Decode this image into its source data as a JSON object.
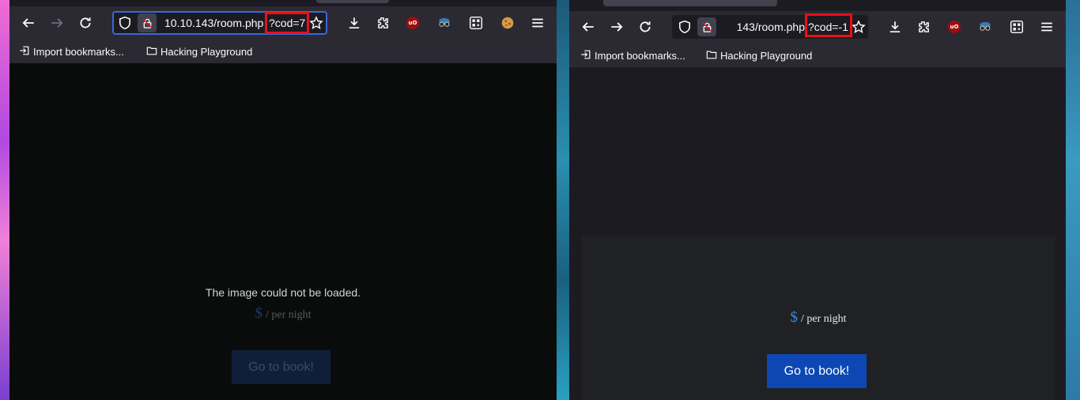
{
  "left_window": {
    "url_main": "10.10.143/room.php",
    "url_highlight": "?cod=7",
    "bookmarks": {
      "import": "Import bookmarks...",
      "folder": "Hacking Playground"
    },
    "image_error": "The image could not be loaded.",
    "price_symbol": "$",
    "price_suffix": "/ per night",
    "book_button": "Go to book!"
  },
  "right_window": {
    "url_main": "143/room.php",
    "url_highlight": "?cod=-1",
    "bookmarks": {
      "import": "Import bookmarks...",
      "folder": "Hacking Playground"
    },
    "price_symbol": "$",
    "price_suffix": "/ per night",
    "book_button": "Go to book!"
  },
  "colors": {
    "highlight_box": "#e8101a",
    "button_active": "#0d47b4",
    "button_dim": "#0f1f3a",
    "price_blue": "#3c8be0",
    "focus_ring": "#3d66d9"
  },
  "icons": [
    "back-arrow-icon",
    "forward-arrow-icon",
    "reload-icon",
    "shield-icon",
    "lock-slash-icon",
    "star-icon",
    "download-icon",
    "extensions-icon",
    "ublock-icon",
    "spy-glasses-icon",
    "qr-icon",
    "cookie-icon",
    "hamburger-menu-icon",
    "import-icon",
    "folder-icon"
  ]
}
